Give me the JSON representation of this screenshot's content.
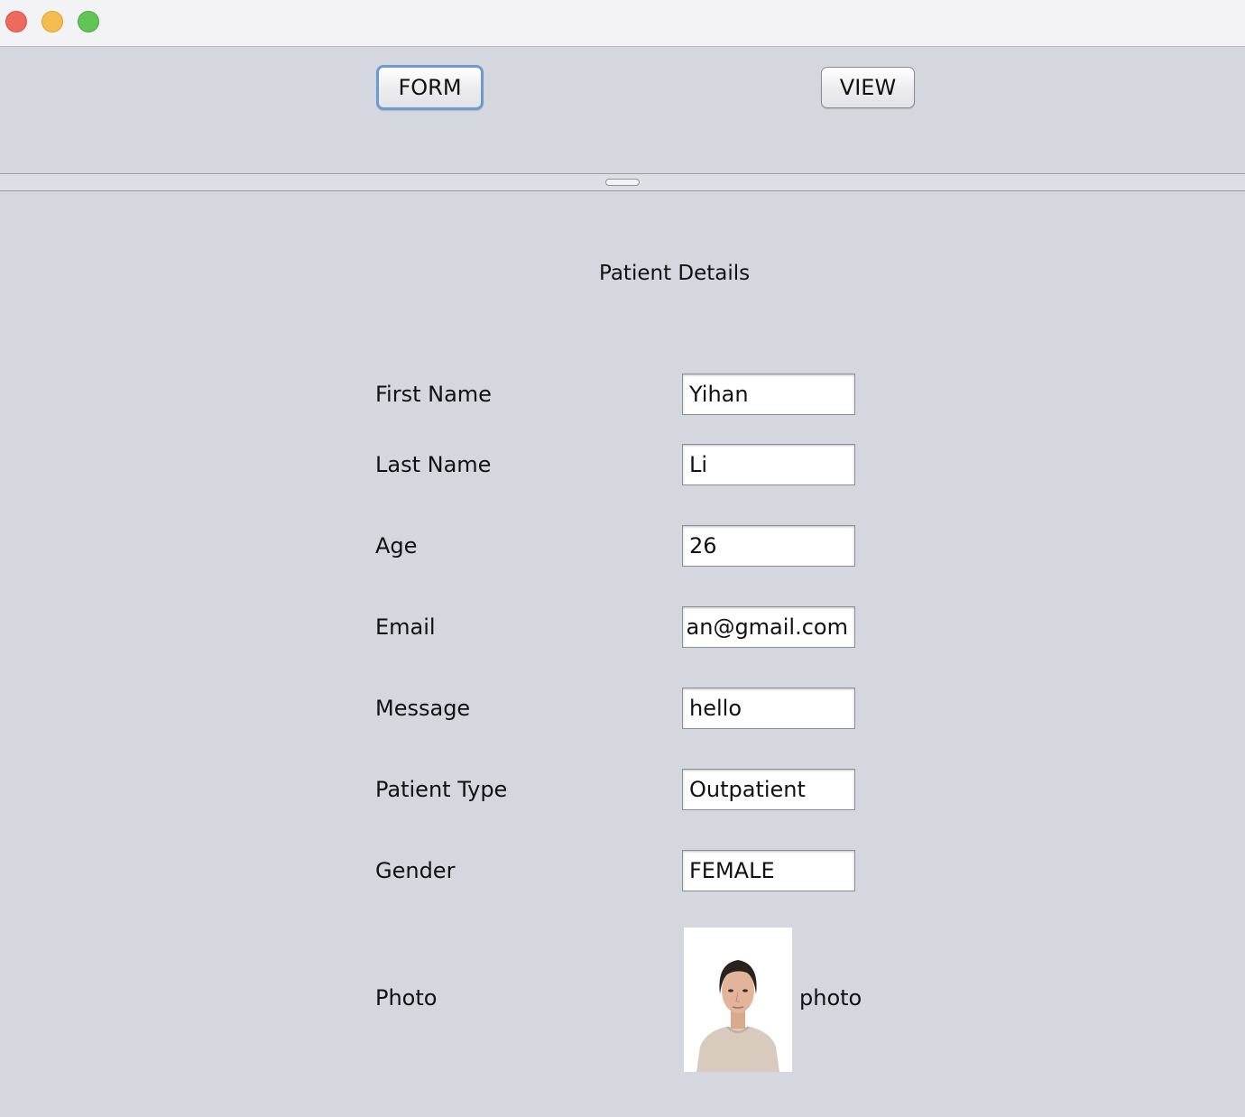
{
  "window": {
    "controls": [
      "close",
      "minimize",
      "maximize"
    ]
  },
  "toolbar": {
    "form_label": "FORM",
    "view_label": "VIEW"
  },
  "main": {
    "title": "Patient Details",
    "fields": [
      {
        "label": "First Name",
        "value": "Yihan"
      },
      {
        "label": "Last Name",
        "value": "Li"
      },
      {
        "label": "Age",
        "value": "26"
      },
      {
        "label": "Email",
        "value": "ıan@gmail.com"
      },
      {
        "label": "Message",
        "value": "hello"
      },
      {
        "label": "Patient Type",
        "value": "Outpatient"
      },
      {
        "label": "Gender",
        "value": "FEMALE"
      }
    ],
    "photo": {
      "label": "Photo",
      "caption": "photo"
    }
  },
  "colors": {
    "background": "#d5d7de",
    "focus_ring": "#6e9ad0",
    "close": "#ee6a5f",
    "minimize": "#f5bd4f",
    "maximize": "#61c454"
  }
}
